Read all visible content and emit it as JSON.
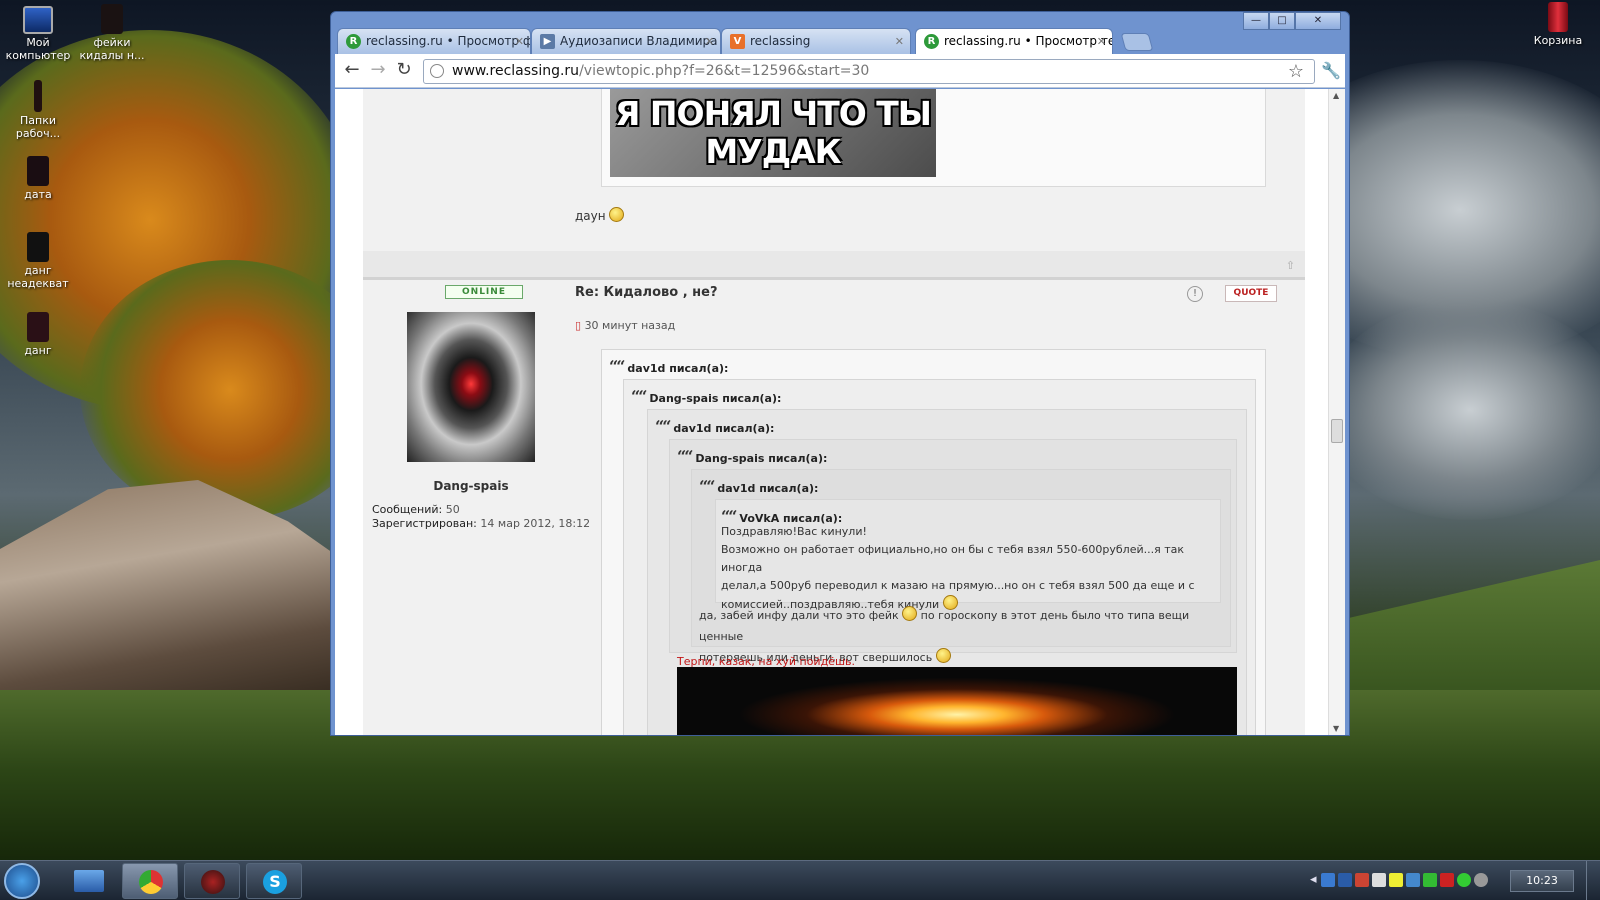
{
  "desktop": {
    "icons": [
      {
        "label": "Мой компьютер",
        "icon": "computer-icon"
      },
      {
        "label": "фейки кидалы н...",
        "icon": "folder-icon"
      },
      {
        "label": "Папки рабоч...",
        "icon": "folder-icon"
      },
      {
        "label": "дата",
        "icon": "file-icon"
      },
      {
        "label": "данг неадекват",
        "icon": "file-icon"
      },
      {
        "label": "данг",
        "icon": "file-icon"
      },
      {
        "label": "Корзина",
        "icon": "recycle-bin-icon"
      }
    ]
  },
  "browser": {
    "tabs": [
      {
        "label": "reclassing.ru • Просмотр фор",
        "favicon": "R",
        "color": "#2e9a3a"
      },
      {
        "label": "Аудиозаписи Владимира Сар",
        "favicon": "▶",
        "color": "#5b7aa6"
      },
      {
        "label": "reclassing",
        "favicon": "V",
        "color": "#e8702a"
      },
      {
        "label": "reclassing.ru • Просмотр тем",
        "favicon": "R",
        "color": "#2e9a3a"
      }
    ],
    "url_host": "www.reclassing.ru",
    "url_path": "/viewtopic.php?f=26&t=12596&start=30",
    "window_controls": {
      "minimize": "—",
      "maximize": "□",
      "close": "✕"
    }
  },
  "prev_post": {
    "meme_lines": [
      "Я ПОНЯЛ ЧТО ТЫ",
      "МУДАК"
    ],
    "text": "даун"
  },
  "post": {
    "status": "ONLINE",
    "title": "Re: Кидалово , не?",
    "quote_button": "QUOTE",
    "report_button": "!",
    "time": "30 минут назад",
    "author": {
      "name": "Dang-spais",
      "messages_label": "Сообщений:",
      "messages": "50",
      "registered_label": "Зарегистрирован:",
      "registered": "14 мар 2012, 18:12"
    },
    "quotes": [
      {
        "author": "dav1d писал(а):"
      },
      {
        "author": "Dang-spais писал(а):"
      },
      {
        "author": "dav1d писал(а):"
      },
      {
        "author": "Dang-spais писал(а):"
      },
      {
        "author": "dav1d писал(а):"
      },
      {
        "author": "VoVkA писал(а):",
        "lines": [
          "Поздравляю!Вас кинули!",
          "Возможно он работает официально,но он бы с тебя взял 550-600рублей...я так иногда",
          "делал,а 500руб переводил к мазаю на прямую...но он с тебя взял 500 да еще и с",
          "комиссией..поздравляю..тебя кинули"
        ]
      }
    ],
    "reply_lines": [
      "да, забей инфу дали что это фейк",
      "по гороскопу в этот день было что типа вещи ценные",
      "потеряешь или деньги, вот свершилось"
    ],
    "signature": "Терпи, казак, на хуй пойдёшь."
  },
  "taskbar": {
    "clock": "10:23",
    "buttons": [
      "show-desktop",
      "chrome",
      "game",
      "skype"
    ]
  }
}
